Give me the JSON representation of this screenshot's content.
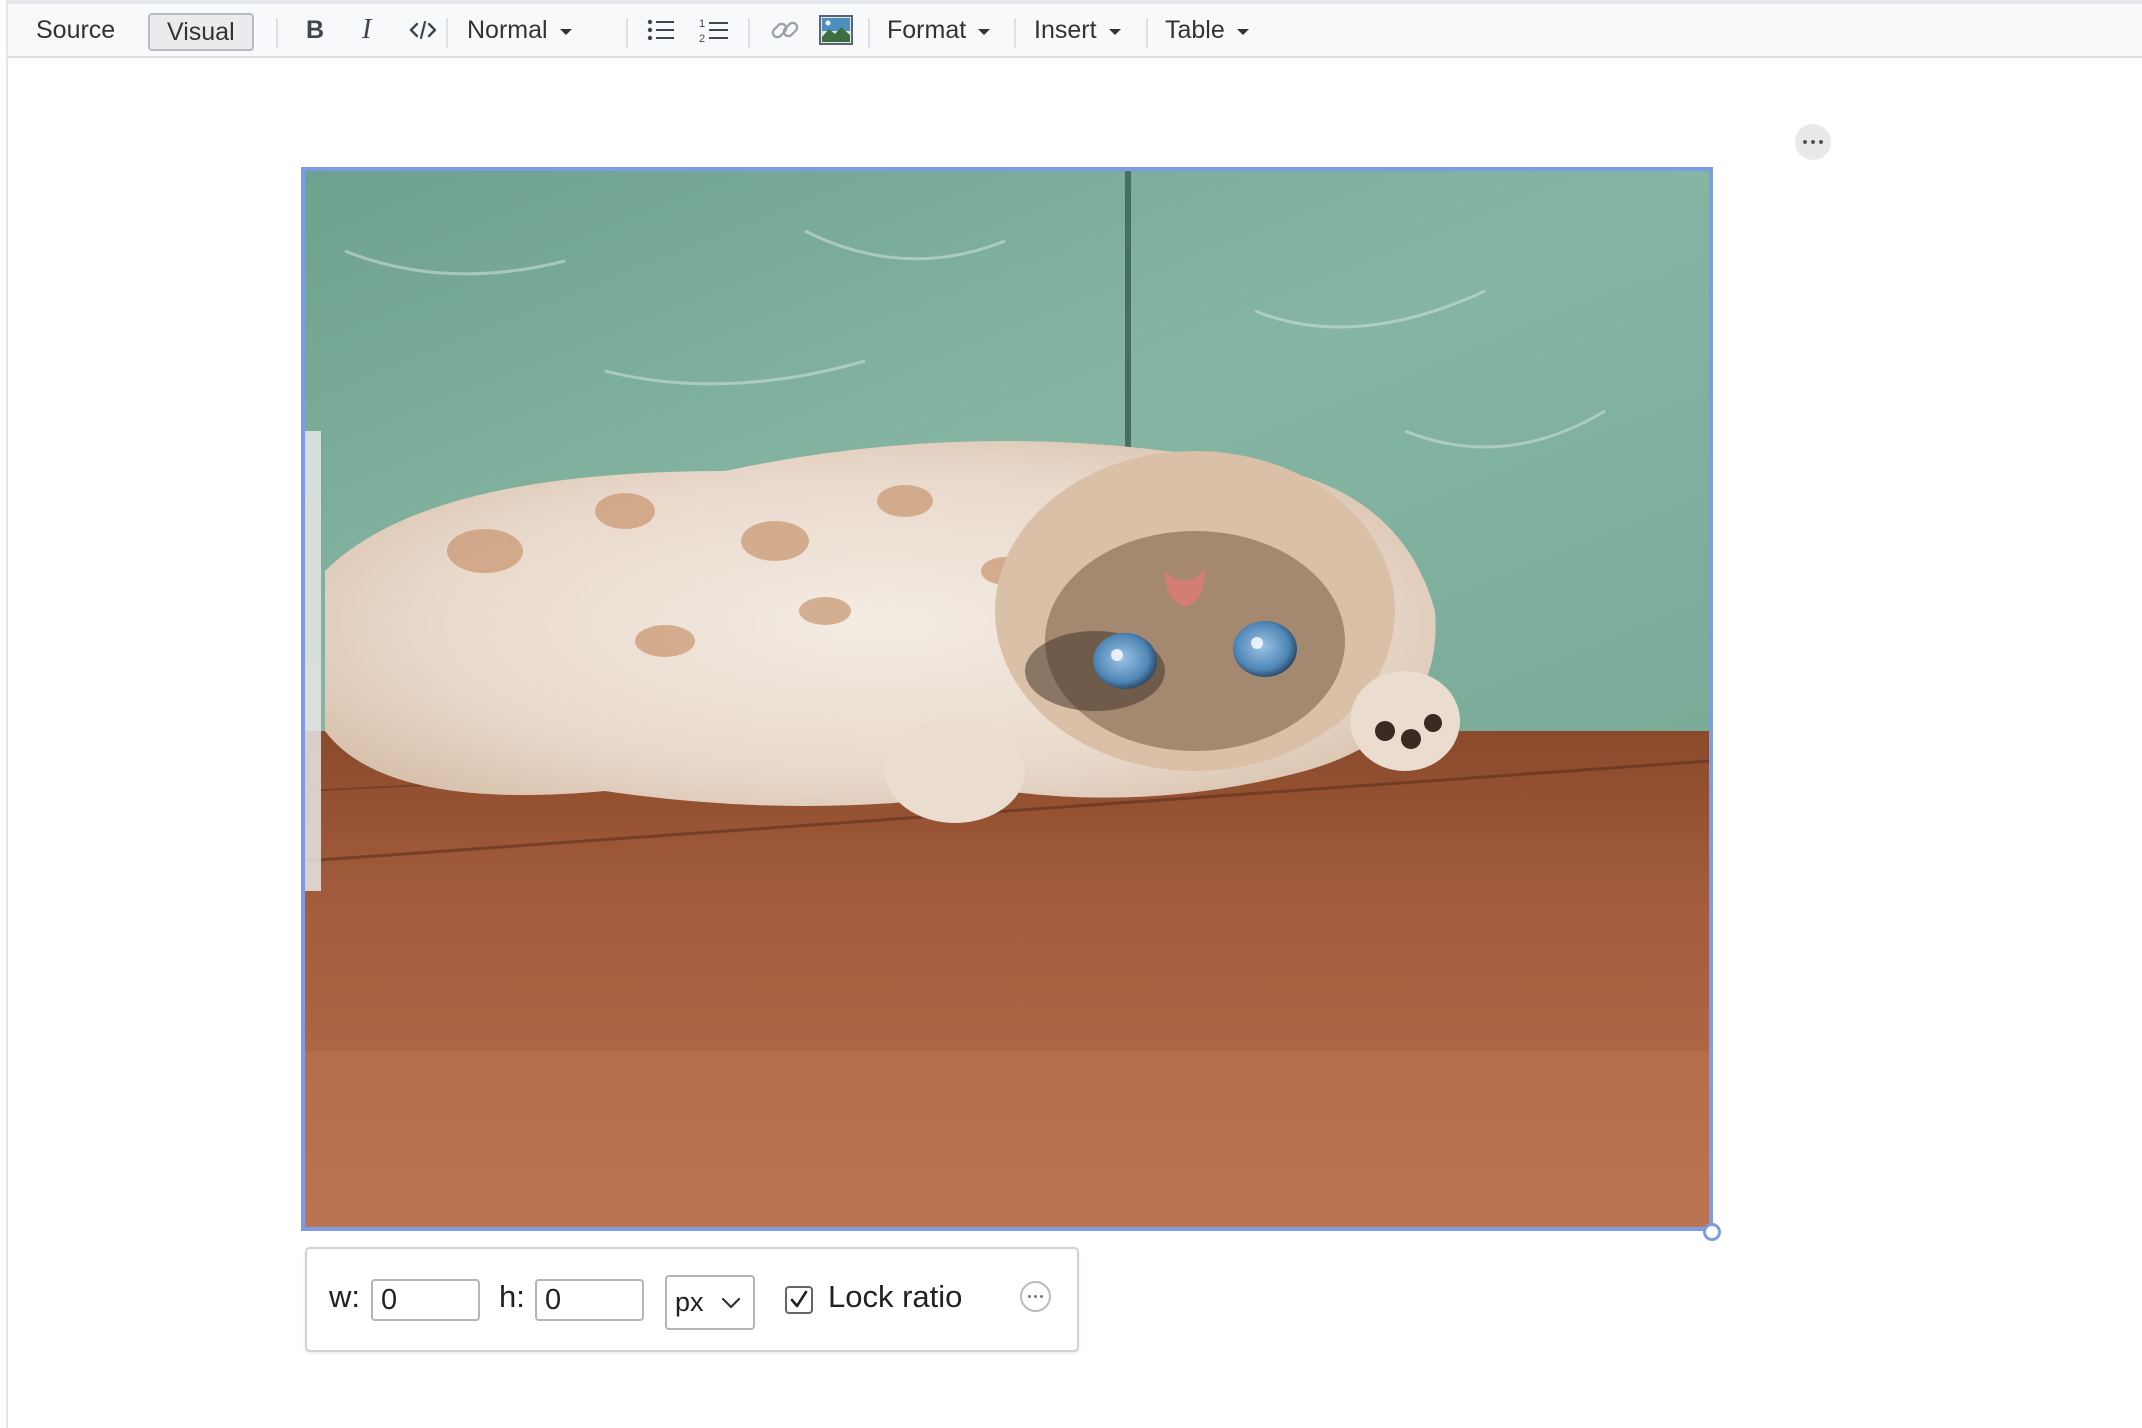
{
  "toolbar": {
    "mode_source": "Source",
    "mode_visual": "Visual",
    "bold": "B",
    "italic": "I",
    "block_style": "Normal",
    "format_menu": "Format",
    "insert_menu": "Insert",
    "table_menu": "Table"
  },
  "image_panel": {
    "width_label": "w:",
    "width_value": "0",
    "height_label": "h:",
    "height_value": "0",
    "unit": "px",
    "lock_ratio_label": "Lock ratio",
    "lock_ratio_checked": true
  },
  "colors": {
    "selection_border": "#7d9ce6",
    "toolbar_bg": "#f7f9fa"
  }
}
